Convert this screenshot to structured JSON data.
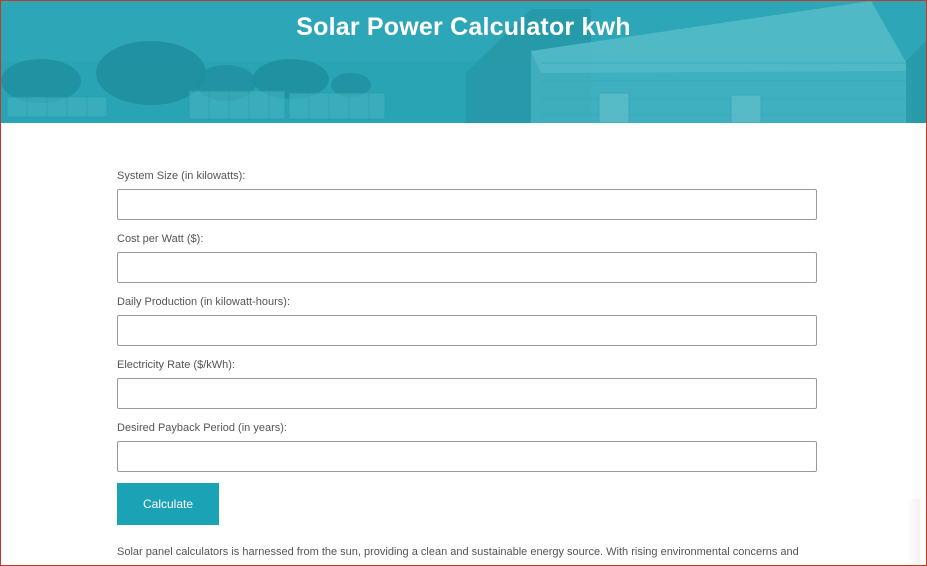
{
  "header": {
    "title": "Solar Power Calculator kwh"
  },
  "form": {
    "fields": [
      {
        "label": "System Size (in kilowatts):",
        "value": ""
      },
      {
        "label": "Cost per Watt ($):",
        "value": ""
      },
      {
        "label": "Daily Production (in kilowatt-hours):",
        "value": ""
      },
      {
        "label": "Electricity Rate ($/kWh):",
        "value": ""
      },
      {
        "label": "Desired Payback Period (in years):",
        "value": ""
      }
    ],
    "button_label": "Calculate"
  },
  "description": "Solar panel calculators is harnessed from the sun, providing a clean and sustainable energy source. With rising environmental concerns and",
  "colors": {
    "header_teal": "#2aa3b4",
    "button_teal": "#1ba3b5",
    "frame_border": "#c0392b"
  }
}
